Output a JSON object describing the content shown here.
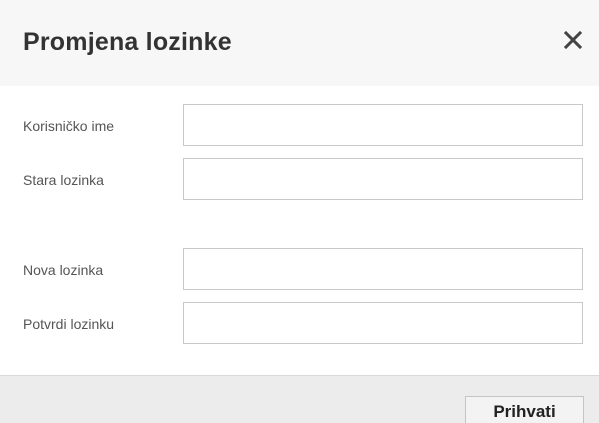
{
  "dialog": {
    "title": "Promjena lozinke",
    "close_icon": "close-icon"
  },
  "form": {
    "fields": [
      {
        "label": "Korisničko ime",
        "value": "",
        "placeholder": ""
      },
      {
        "label": "Stara lozinka",
        "value": "",
        "placeholder": ""
      },
      {
        "label": "Nova lozinka",
        "value": "",
        "placeholder": ""
      },
      {
        "label": "Potvrdi lozinku",
        "value": "",
        "placeholder": ""
      }
    ]
  },
  "footer": {
    "accept_label": "Prihvati"
  }
}
